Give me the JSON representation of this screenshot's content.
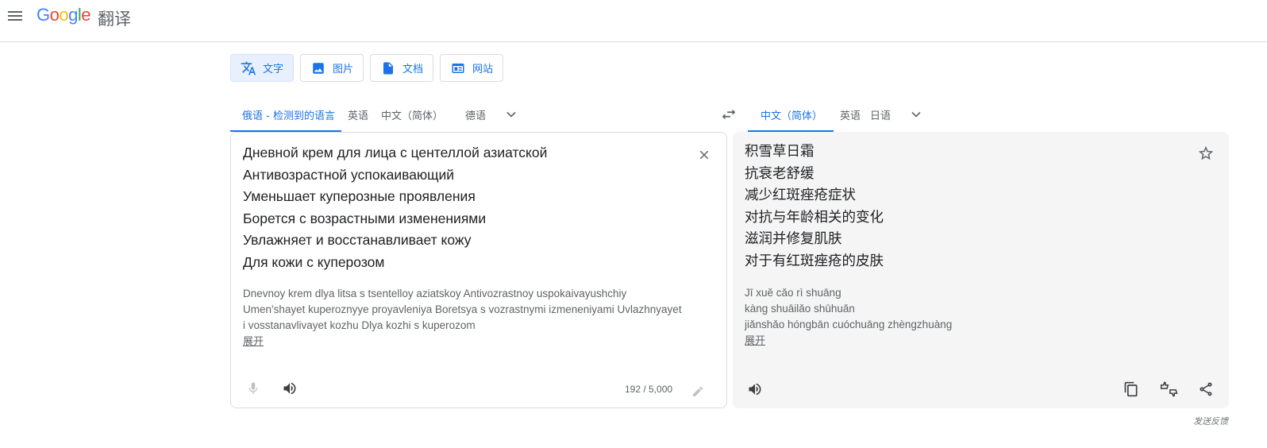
{
  "header": {
    "logo_text": "Google",
    "product_name": "翻译"
  },
  "mode_tabs": [
    {
      "label": "文字",
      "icon": "translate-icon",
      "active": true
    },
    {
      "label": "图片",
      "icon": "image-icon",
      "active": false
    },
    {
      "label": "文档",
      "icon": "document-icon",
      "active": false
    },
    {
      "label": "网站",
      "icon": "website-icon",
      "active": false
    }
  ],
  "source_languages": [
    {
      "label": "俄语 - 检测到的语言",
      "active": true
    },
    {
      "label": "英语",
      "active": false
    },
    {
      "label": "中文（简体）",
      "active": false
    },
    {
      "label": "德语",
      "active": false
    }
  ],
  "target_languages": [
    {
      "label": "中文（简体）",
      "active": true
    },
    {
      "label": "英语",
      "active": false
    },
    {
      "label": "日语",
      "active": false
    }
  ],
  "source": {
    "lines": [
      "Дневной крем для лица с центеллой азиатской",
      "Антивозрастной успокаивающий",
      "Уменьшает куперозные проявления",
      "Борется с возрастными изменениями",
      "Увлажняет и восстанавливает кожу",
      "Для кожи с куперозом"
    ],
    "transliteration": [
      "Dnevnoy krem dlya litsa s tsentelloy aziatskoy Antivozrastnoy uspokaivayushchiy",
      "Umen'shayet kuperoznyye proyavleniya Boretsya s vozrastnymi izmeneniyami Uvlazhnyayet",
      "i vosstanavlivayet kozhu Dlya kozhi s kuperozom"
    ],
    "expand_label": "展开",
    "char_count": "192 / 5,000"
  },
  "target": {
    "lines": [
      "积雪草日霜",
      "抗衰老舒缓",
      "减少红斑痤疮症状",
      "对抗与年龄相关的变化",
      "滋润并修复肌肤",
      "对于有红斑痤疮的皮肤"
    ],
    "transliteration": [
      "Jī xuě cǎo rì shuāng",
      "kàng shuāilǎo shūhuǎn",
      "jiǎnshǎo hóngbān cuóchuāng zhèngzhuàng"
    ],
    "expand_label": "展开"
  },
  "feedback_label": "发送反馈",
  "colors": {
    "accent": "#1a73e8",
    "icon_gray": "#5f6368",
    "panel_bg": "#f5f5f5"
  }
}
